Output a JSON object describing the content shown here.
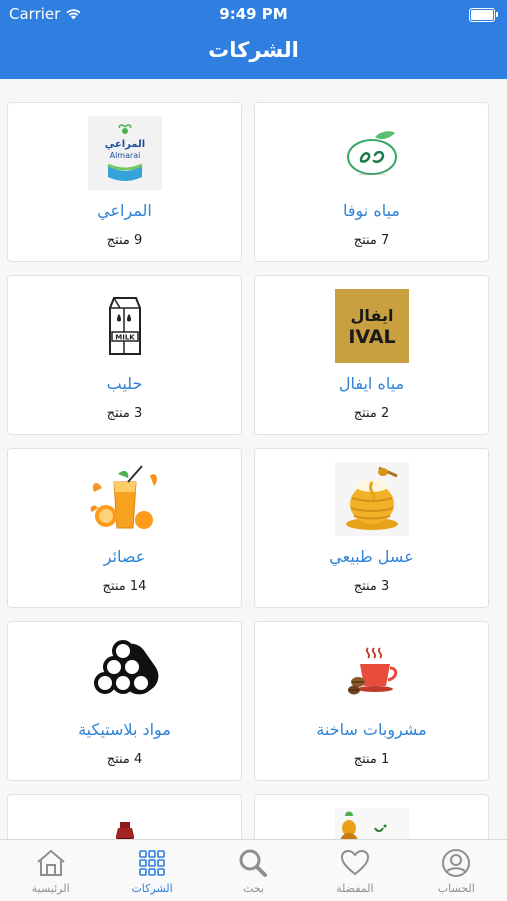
{
  "status_bar": {
    "carrier": "Carrier",
    "time": "9:49 PM"
  },
  "header": {
    "title": "الشركات"
  },
  "companies": [
    {
      "name": "مياه نوفا",
      "count": "7 منتج",
      "icon": "nova-water-logo"
    },
    {
      "name": "المراعي",
      "count": "9 منتج",
      "icon": "almarai-logo"
    },
    {
      "name": "مياه ايفال",
      "count": "2 منتج",
      "icon": "ival-water-logo"
    },
    {
      "name": "حليب",
      "count": "3 منتج",
      "icon": "milk-carton-icon"
    },
    {
      "name": "عسل طبيعي",
      "count": "3 منتج",
      "icon": "honey-pot-icon"
    },
    {
      "name": "عصائر",
      "count": "14 منتج",
      "icon": "orange-juice-icon"
    },
    {
      "name": "مشروبات ساخنة",
      "count": "1 منتج",
      "icon": "hot-drink-cup-icon"
    },
    {
      "name": "مواد بلاستيكية",
      "count": "4 منتج",
      "icon": "plastic-pipes-icon"
    }
  ],
  "ival_logo_text": {
    "arabic": "ايفال",
    "latin": "IVAL"
  },
  "almarai_logo_text": {
    "arabic": "المراعي",
    "latin": "Almarai"
  },
  "milk_carton_text": "MILK",
  "tabs": [
    {
      "label": "الرئيسية",
      "icon": "home-icon"
    },
    {
      "label": "الشركات",
      "icon": "grid-icon",
      "active": true
    },
    {
      "label": "بحث",
      "icon": "search-icon"
    },
    {
      "label": "المفضلة",
      "icon": "heart-icon"
    },
    {
      "label": "الحساب",
      "icon": "user-icon"
    }
  ],
  "colors": {
    "primary": "#2e7fe0",
    "link": "#2f83d8",
    "inactive_tab": "#8e8e93"
  }
}
